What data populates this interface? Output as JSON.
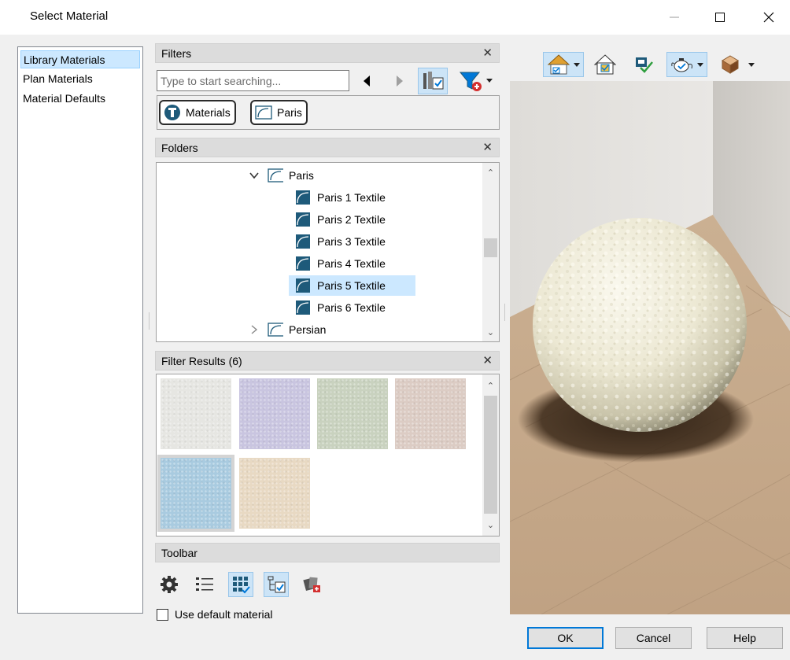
{
  "window": {
    "title": "Select Material",
    "minimize_icon": "minimize-icon",
    "maximize_icon": "maximize-icon",
    "close_icon": "close-icon"
  },
  "left_panel": {
    "items": [
      {
        "label": "Library Materials",
        "selected": true
      },
      {
        "label": "Plan Materials",
        "selected": false
      },
      {
        "label": "Material Defaults",
        "selected": false
      }
    ]
  },
  "filters": {
    "header": "Filters",
    "search_placeholder": "Type to start searching...",
    "chips": [
      {
        "label": "Materials",
        "icon": "catalog-icon"
      },
      {
        "label": "Paris",
        "icon": "folder-icon"
      }
    ]
  },
  "folders": {
    "header": "Folders",
    "tree": [
      {
        "label": "Paris",
        "type": "folder",
        "expanded": true,
        "selected": false
      },
      {
        "label": "Paris 1 Textile",
        "type": "material",
        "selected": false
      },
      {
        "label": "Paris 2 Textile",
        "type": "material",
        "selected": false
      },
      {
        "label": "Paris 3 Textile",
        "type": "material",
        "selected": false
      },
      {
        "label": "Paris 4 Textile",
        "type": "material",
        "selected": false
      },
      {
        "label": "Paris 5 Textile",
        "type": "material",
        "selected": true
      },
      {
        "label": "Paris 6 Textile",
        "type": "material",
        "selected": false
      },
      {
        "label": "Persian",
        "type": "folder",
        "expanded": false,
        "selected": false
      }
    ]
  },
  "filter_results": {
    "header": "Filter Results (6)",
    "swatches": [
      {
        "color": "#e6e6e2"
      },
      {
        "color": "#c9c5e0"
      },
      {
        "color": "#c9d2bf"
      },
      {
        "color": "#dcccc4"
      },
      {
        "color": "#a9cbe0",
        "selected": true
      },
      {
        "color": "#e8d9c3"
      }
    ]
  },
  "toolbar": {
    "header": "Toolbar",
    "icons": [
      "settings-gear-icon",
      "list-view-icon",
      "thumbnail-view-icon",
      "tree-view-icon",
      "add-material-icon"
    ]
  },
  "use_default": {
    "label": "Use default material",
    "checked": false
  },
  "buttons": {
    "ok": "OK",
    "cancel": "Cancel",
    "help": "Help"
  },
  "colors": {
    "accent": "#0078d7",
    "selection": "#cce8ff",
    "material_icon": "#1e5a7a"
  }
}
